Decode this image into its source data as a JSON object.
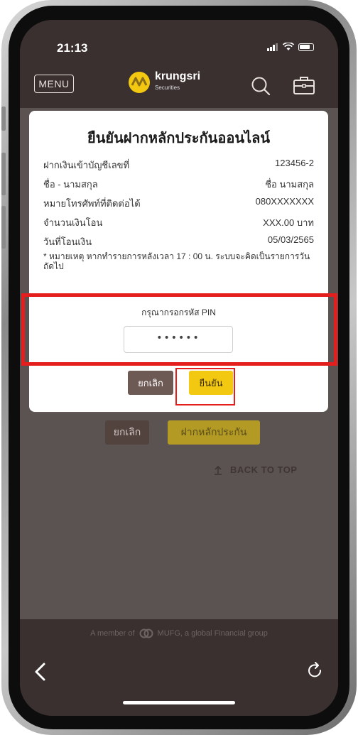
{
  "status_bar": {
    "time": "21:13"
  },
  "header": {
    "menu_label": "MENU",
    "brand_name": "krungsri",
    "brand_sub": "Securities"
  },
  "background": {
    "cancel_label": "ยกเลิก",
    "deposit_label": "ฝากหลักประกัน",
    "back_to_top_label": "BACK TO TOP"
  },
  "footer": {
    "member_prefix": "A member of",
    "member_suffix": "MUFG, a global Financial group"
  },
  "modal": {
    "title": "ยืนยันฝากหลักประกันออนไลน์",
    "rows": [
      {
        "label": "ฝากเงินเข้าบัญชีเลขที่",
        "value": "123456-2"
      },
      {
        "label": "ชื่อ - นามสกุล",
        "value": "ชื่อ นามสกุล"
      },
      {
        "label": "หมายโทรศัพท์ที่ติดต่อได้",
        "value": "080XXXXXXX"
      },
      {
        "label": "จำนวนเงินโอน",
        "value": "XXX.00 บาท"
      },
      {
        "label": "วันที่โอนเงิน",
        "value": "05/03/2565"
      }
    ],
    "note": "* หมายเหตุ หากทำรายการหลังเวลา 17 : 00 น. ระบบจะคิดเป็นรายการวันถัดไป",
    "pin_label": "กรุณากรอกรหัส PIN",
    "pin_value": "••••••",
    "cancel_label": "ยกเลิก",
    "confirm_label": "ยืนยัน"
  },
  "colors": {
    "brand_yellow": "#f2c811",
    "brand_brown": "#6e5a55",
    "highlight_red": "#e41d1d"
  },
  "icons": [
    "signal-icon",
    "wifi-icon",
    "battery-icon",
    "search-icon",
    "briefcase-icon",
    "back-arrow-icon",
    "refresh-icon",
    "mufg-logo-icon",
    "arrow-up-icon"
  ]
}
